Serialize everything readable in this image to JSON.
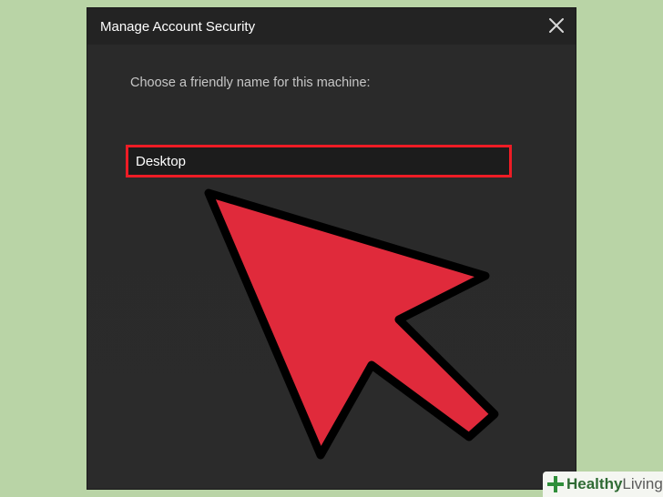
{
  "dialog": {
    "title": "Manage Account Security",
    "prompt": "Choose a friendly name for this machine:",
    "name_field": {
      "value": "Desktop"
    }
  },
  "icons": {
    "close": "close-icon",
    "pointer": "arrow-pointer-icon"
  },
  "colors": {
    "highlight": "#ee1c25",
    "arrow_fill": "#e02a3b",
    "page_background": "#b9d4a6",
    "dialog_background": "#2a2a2a"
  },
  "watermark": {
    "word1": "Healthy",
    "word2": "Living"
  }
}
